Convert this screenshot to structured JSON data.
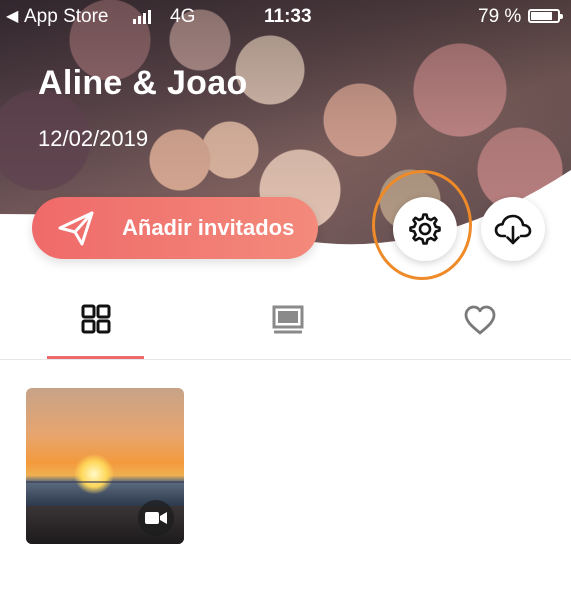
{
  "status_bar": {
    "back_glyph": "◀",
    "carrier": "App Store",
    "network": "4G",
    "time": "11:33",
    "battery": "79 %"
  },
  "event": {
    "title": "Aline & Joao",
    "date": "12/02/2019"
  },
  "actions": {
    "add_guests_label": "Añadir invitados",
    "add_guests_icon": "paper-plane-icon",
    "settings_icon": "gear-icon",
    "download_icon": "cloud-download-icon"
  },
  "tabs": [
    {
      "icon": "grid-icon",
      "selected": true
    },
    {
      "icon": "slideshow-icon",
      "selected": false
    },
    {
      "icon": "heart-icon",
      "selected": false
    }
  ],
  "media": [
    {
      "type": "video",
      "badge_icon": "video-camera-icon"
    }
  ],
  "colors": {
    "accent": "#ef6a6a",
    "highlight_ring": "#ee8a28"
  }
}
